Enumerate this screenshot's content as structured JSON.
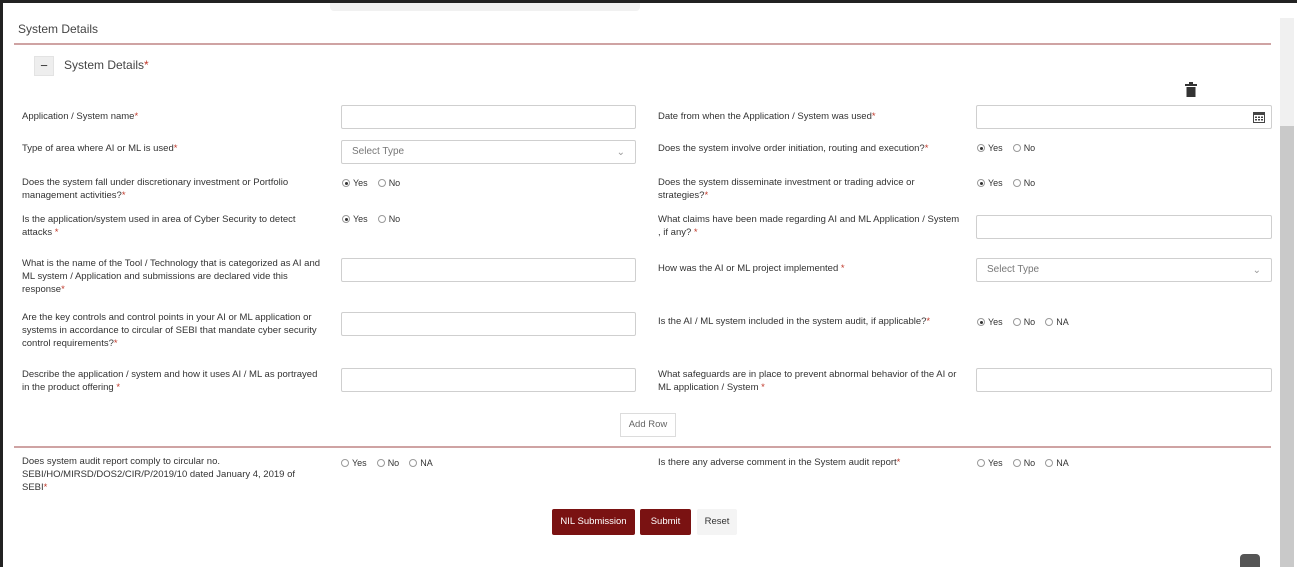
{
  "panel": {
    "title": "System Details"
  },
  "section": {
    "toggle_symbol": "−",
    "title": "System Details",
    "required_mark": "*"
  },
  "fields": {
    "app_name": {
      "label": "Application / System name",
      "req": "*"
    },
    "date_used": {
      "label": "Date from when the Application / System was used",
      "req": "*"
    },
    "area_type": {
      "label": "Type of area where AI or ML is used",
      "req": "*",
      "select_value": "Select Type"
    },
    "order_execution": {
      "label": "Does the system involve order initiation, routing and execution?",
      "req": "*",
      "options": [
        "Yes",
        "No"
      ],
      "selected": "Yes"
    },
    "discretionary": {
      "label": "Does the system fall under discretionary investment or Portfolio management activities?",
      "req": "*",
      "options": [
        "Yes",
        "No"
      ],
      "selected": "Yes"
    },
    "disseminate_advice": {
      "label": "Does the system disseminate investment or trading advice or strategies?",
      "req": "*",
      "options": [
        "Yes",
        "No"
      ],
      "selected": "Yes"
    },
    "cyber_security": {
      "label": "Is the application/system used in area of Cyber Security to detect attacks ",
      "req": "*",
      "options": [
        "Yes",
        "No"
      ],
      "selected": "Yes"
    },
    "claims": {
      "label": "What claims have been made regarding AI and ML Application / System , if any? ",
      "req": "*"
    },
    "tool_name": {
      "label": "What is the name of the Tool / Technology that is categorized as AI and ML system / Application and submissions are declared vide this response",
      "req": "*"
    },
    "implementation": {
      "label": "How was the AI or ML project implemented ",
      "req": "*",
      "select_value": "Select Type"
    },
    "key_controls": {
      "label": "Are the key controls and control points in your AI or ML application or systems in accordance to circular of SEBI that mandate cyber security control requirements?",
      "req": "*"
    },
    "system_audit_included": {
      "label": "Is the AI / ML system included in the system audit, if applicable?",
      "req": "*",
      "options": [
        "Yes",
        "No",
        "NA"
      ],
      "selected": "Yes"
    },
    "describe_app": {
      "label": "Describe the application / system and how it uses AI / ML as portrayed in the product offering ",
      "req": "*"
    },
    "safeguards": {
      "label": "What safeguards are in place to prevent abnormal behavior of the AI or ML application / System ",
      "req": "*"
    },
    "audit_comply": {
      "label": "Does system audit report comply to circular no. SEBI/HO/MIRSD/DOS2/CIR/P/2019/10 dated January 4, 2019 of SEBI",
      "req": "*",
      "options": [
        "Yes",
        "No",
        "NA"
      ],
      "selected": ""
    },
    "adverse_comment": {
      "label": "Is there any adverse comment in the System audit report",
      "req": "*",
      "options": [
        "Yes",
        "No",
        "NA"
      ],
      "selected": ""
    }
  },
  "buttons": {
    "add_row": "Add Row",
    "nil_submission": "NIL Submission",
    "submit": "Submit",
    "reset": "Reset"
  },
  "icons": {
    "delete": "trash-icon",
    "calendar": "calendar-icon",
    "dropdown": "chevron-down-icon",
    "collapse": "minus-icon"
  },
  "colors": {
    "brand": "#7a1212",
    "divider": "#cfa3a3",
    "required": "#c0392b"
  }
}
